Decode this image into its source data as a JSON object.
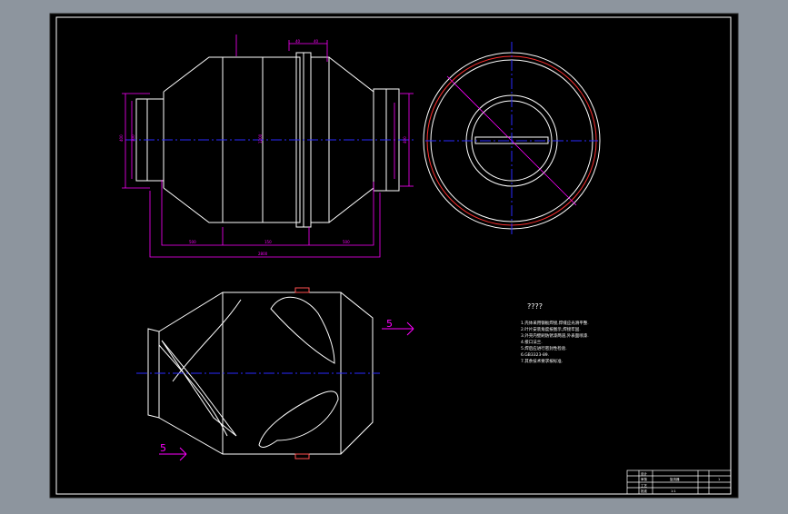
{
  "drawing": {
    "notes_title": "????",
    "notes": [
      "1.壳体采用钢板焊接,焊缝应光滑平整.",
      "2.叶片安装角度按图示,焊接牢固.",
      "3.外壳内壁刷防锈漆两道,外表面喷漆.",
      "4.接口法兰.",
      "5.焊后应进行密封性检验.",
      "6.GB3323-89.",
      "7.其余技术要求按标准."
    ],
    "section_mark": "5",
    "title_block": {
      "part_name": "旋流器",
      "scale": "1:1",
      "sheet": "1",
      "rows": [
        "设计",
        "审核",
        "工艺",
        "批准"
      ]
    },
    "colors": {
      "background": "#000000",
      "outline": "#ffffff",
      "dimension": "#ff00ff",
      "centerline": "#0000ff",
      "accent": "#ff0000",
      "frame": "#ffffff"
    }
  }
}
